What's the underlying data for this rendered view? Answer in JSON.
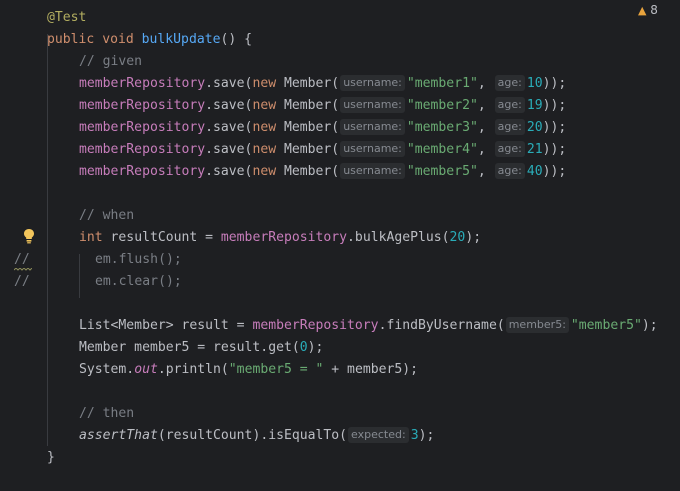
{
  "inspections": {
    "warning_count": "8",
    "warning_icon": "warning-triangle-icon"
  },
  "code": {
    "annotation": "@Test",
    "signature": {
      "public": "public",
      "void": "void",
      "name": "bulkUpdate",
      "rest": "() {"
    },
    "given_comment": "// given",
    "save_lines": [
      {
        "repo": "memberRepository",
        "call": ".save(",
        "new": "new",
        "cls": " Member(",
        "hint1": "username:",
        "str": "\"member1\"",
        "comma": ", ",
        "hint2": "age:",
        "num": "10",
        "end": "));"
      },
      {
        "repo": "memberRepository",
        "call": ".save(",
        "new": "new",
        "cls": " Member(",
        "hint1": "username:",
        "str": "\"member2\"",
        "comma": ", ",
        "hint2": "age:",
        "num": "19",
        "end": "));"
      },
      {
        "repo": "memberRepository",
        "call": ".save(",
        "new": "new",
        "cls": " Member(",
        "hint1": "username:",
        "str": "\"member3\"",
        "comma": ", ",
        "hint2": "age:",
        "num": "20",
        "end": "));"
      },
      {
        "repo": "memberRepository",
        "call": ".save(",
        "new": "new",
        "cls": " Member(",
        "hint1": "username:",
        "str": "\"member4\"",
        "comma": ", ",
        "hint2": "age:",
        "num": "21",
        "end": "));"
      },
      {
        "repo": "memberRepository",
        "call": ".save(",
        "new": "new",
        "cls": " Member(",
        "hint1": "username:",
        "str": "\"member5\"",
        "comma": ", ",
        "hint2": "age:",
        "num": "40",
        "end": "));"
      }
    ],
    "when_comment": "// when",
    "bulk": {
      "int": "int",
      "var": " resultCount = ",
      "repo": "memberRepository",
      "call": ".bulkAgePlus(",
      "num": "20",
      "end": ");"
    },
    "line_comment_marker": "//",
    "flush": "em.flush();",
    "clear": "em.clear();",
    "find": {
      "pre": "List<Member> result = ",
      "repo": "memberRepository",
      "call": ".findByUsername(",
      "hint": "member5:",
      "str": "\"member5\"",
      "end": ");"
    },
    "get": {
      "pre": "Member member5 = result.get(",
      "num": "0",
      "end": ");"
    },
    "print": {
      "sys": "System.",
      "out": "out",
      "call": ".println(",
      "str": "\"member5 = \"",
      "end": " + member5);"
    },
    "then_comment": "// then",
    "assert": {
      "fn": "assertThat",
      "mid": "(resultCount).isEqualTo(",
      "hint": "expected:",
      "num": "3",
      "end": ");"
    },
    "close_brace": "}"
  }
}
